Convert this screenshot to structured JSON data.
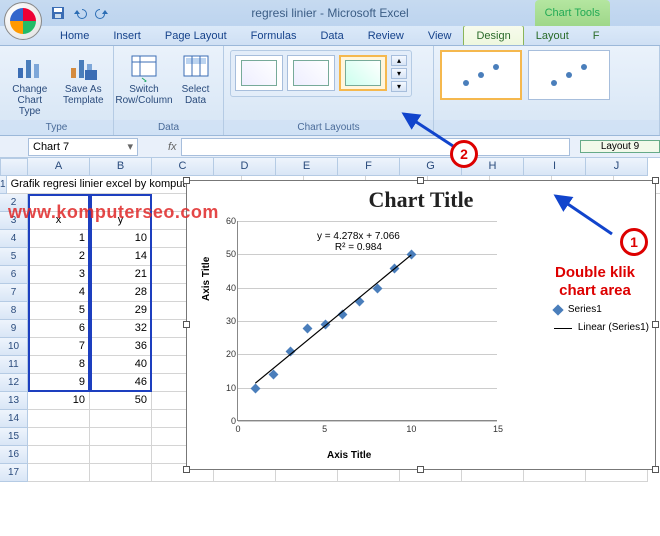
{
  "window": {
    "title": "regresi linier - Microsoft Excel",
    "chart_tools": "Chart Tools"
  },
  "tabs": {
    "home": "Home",
    "insert": "Insert",
    "page_layout": "Page Layout",
    "formulas": "Formulas",
    "data": "Data",
    "review": "Review",
    "view": "View",
    "design": "Design",
    "layout": "Layout",
    "format": "F"
  },
  "ribbon": {
    "change_type": "Change Chart Type",
    "save_template": "Save As Template",
    "switch": "Switch Row/Column",
    "select_data": "Select Data",
    "type_label": "Type",
    "data_label": "Data",
    "chart_layouts": "Chart Layouts"
  },
  "fbar": {
    "namebox": "Chart 7",
    "fx": "fx",
    "layout_label": "Layout 9"
  },
  "cols": [
    "A",
    "B",
    "C",
    "D",
    "E",
    "F",
    "G",
    "H",
    "I",
    "J"
  ],
  "rownums": [
    "1",
    "2",
    "3",
    "4",
    "5",
    "6",
    "7",
    "8",
    "9",
    "10",
    "11",
    "12",
    "13",
    "14",
    "15",
    "16",
    "17"
  ],
  "sheet": {
    "a1": "Grafik regresi linier excel by komputerseo.com",
    "a3": "x",
    "b3": "y",
    "rows": [
      {
        "x": "1",
        "y": "10"
      },
      {
        "x": "2",
        "y": "14"
      },
      {
        "x": "3",
        "y": "21"
      },
      {
        "x": "4",
        "y": "28"
      },
      {
        "x": "5",
        "y": "29"
      },
      {
        "x": "6",
        "y": "32"
      },
      {
        "x": "7",
        "y": "36"
      },
      {
        "x": "8",
        "y": "40"
      },
      {
        "x": "9",
        "y": "46"
      },
      {
        "x": "10",
        "y": "50"
      }
    ]
  },
  "watermark": "www.komputerseo.com",
  "chart": {
    "title": "Chart Title",
    "yaxis": "Axis Title",
    "xaxis": "Axis Title",
    "eq": "y = 4.278x + 7.066",
    "r2": "R² = 0.984",
    "legend1": "Series1",
    "legend2": "Linear (Series1)",
    "yticks": [
      "0",
      "10",
      "20",
      "30",
      "40",
      "50",
      "60"
    ],
    "xticks": [
      "0",
      "5",
      "10",
      "15"
    ]
  },
  "chart_data": {
    "type": "scatter",
    "title": "Chart Title",
    "xlabel": "Axis Title",
    "ylabel": "Axis Title",
    "xlim": [
      0,
      15
    ],
    "ylim": [
      0,
      60
    ],
    "series": [
      {
        "name": "Series1",
        "x": [
          1,
          2,
          3,
          4,
          5,
          6,
          7,
          8,
          9,
          10
        ],
        "y": [
          10,
          14,
          21,
          28,
          29,
          32,
          36,
          40,
          46,
          50
        ]
      },
      {
        "name": "Linear (Series1)",
        "type": "line",
        "equation": "y = 4.278x + 7.066",
        "r2": 0.984
      }
    ]
  },
  "anno": {
    "one": "1",
    "two": "2",
    "text": "Double klik\nchart area"
  }
}
